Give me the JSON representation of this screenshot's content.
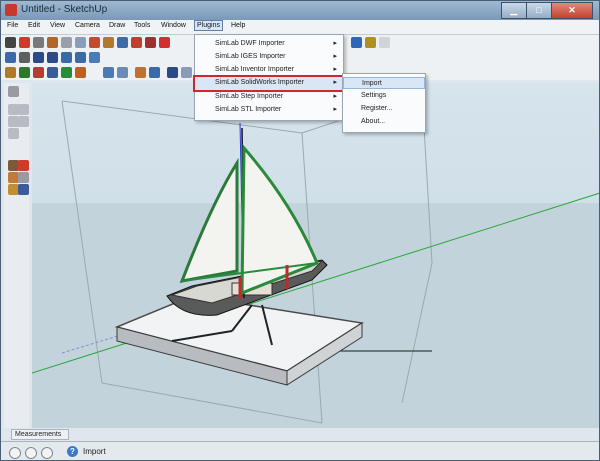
{
  "window": {
    "title": "Untitled - SketchUp"
  },
  "menubar": {
    "items": [
      "File",
      "Edit",
      "View",
      "Camera",
      "Draw",
      "Tools",
      "Window",
      "Plugins",
      "Help"
    ]
  },
  "plugins_menu": {
    "items": [
      {
        "label": "SimLab DWF Importer",
        "has_submenu": true
      },
      {
        "label": "SimLab IGES Importer",
        "has_submenu": true
      },
      {
        "label": "SimLab Inventor Importer",
        "has_submenu": true
      },
      {
        "label": "SimLab SolidWorks Importer",
        "has_submenu": true,
        "highlighted": true
      },
      {
        "label": "SimLab Step Importer",
        "has_submenu": true
      },
      {
        "label": "SimLab STL Importer",
        "has_submenu": true
      }
    ]
  },
  "submenu": {
    "items": [
      "Import",
      "Settings",
      "Register...",
      "About..."
    ]
  },
  "measurements": {
    "label": "Measurements"
  },
  "statusbar": {
    "help_text": "Import",
    "help_icon": "?"
  },
  "colors": {
    "accent_highlight": "#d0262d",
    "menu_selection": "#d9e6f5"
  }
}
